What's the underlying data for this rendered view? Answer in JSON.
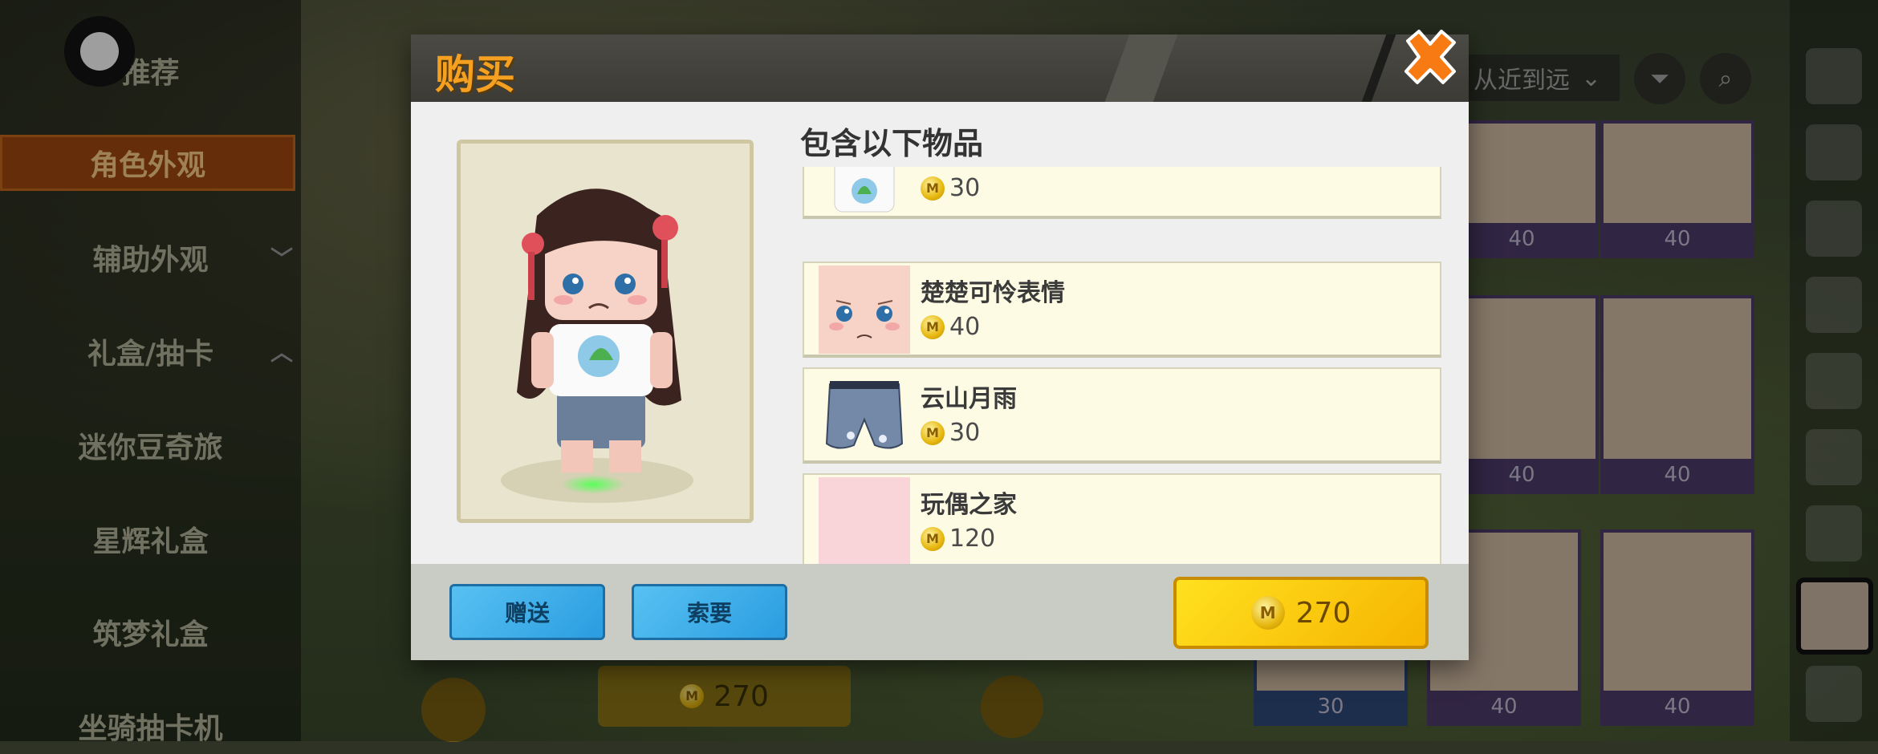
{
  "background": {
    "sidebar_items": [
      {
        "label": "推荐"
      },
      {
        "label": "角色外观",
        "active": true
      },
      {
        "label": "辅助外观",
        "chevron": "﹀"
      },
      {
        "label": "礼盒/抽卡",
        "chevron": "︿"
      },
      {
        "label": "迷你豆奇旅"
      },
      {
        "label": "星辉礼盒"
      },
      {
        "label": "筑梦礼盒"
      },
      {
        "label": "坐骑抽卡机"
      }
    ],
    "sort_label": "从近到远",
    "grid_prices": [
      "40",
      "40",
      "40",
      "40",
      "30",
      "40",
      "40"
    ],
    "bottom_price": "270"
  },
  "dialog": {
    "title": "购买",
    "contains_title": "包含以下物品",
    "items": [
      {
        "name": "",
        "price": "30"
      },
      {
        "name": "楚楚可怜表情",
        "price": "40"
      },
      {
        "name": "云山月雨",
        "price": "30"
      },
      {
        "name": "玩偶之家",
        "price": "120"
      }
    ],
    "gift_label": "赠送",
    "request_label": "索要",
    "total_price": "270"
  },
  "colors": {
    "accent_orange": "#f5a021",
    "buy_yellow": "#ffd60a",
    "button_blue": "#3aaeea"
  }
}
